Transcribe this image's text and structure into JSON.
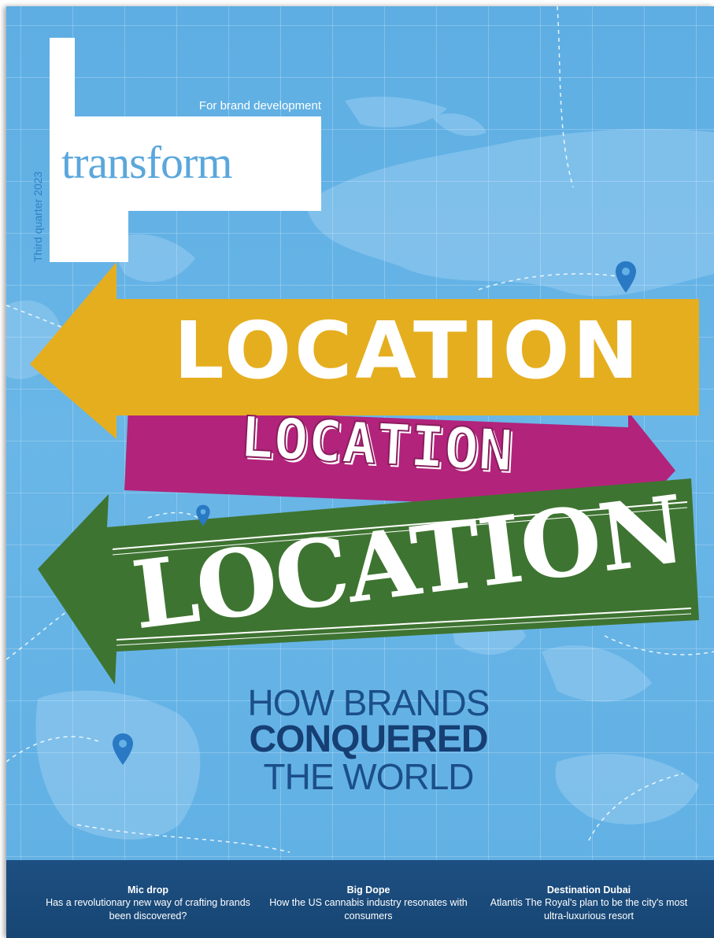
{
  "masthead": {
    "tagline": "For brand development",
    "title": "transform",
    "issue": "Third quarter 2023"
  },
  "arrows": {
    "top": {
      "text": "LOCATION",
      "color": "#e5ae1f"
    },
    "middle": {
      "text": "LOCATION",
      "color": "#b2237b"
    },
    "bottom": {
      "text": "LOCATION",
      "color": "#3e7431"
    }
  },
  "headline": {
    "line1": "HOW BRANDS",
    "line2": "CONQUERED",
    "line3": "THE WORLD"
  },
  "teasers": [
    {
      "title": "Mic drop",
      "body": "Has a revolutionary new way of crafting brands been discovered?"
    },
    {
      "title": "Big Dope",
      "body": "How the US cannabis industry resonates with consumers"
    },
    {
      "title": "Destination Dubai",
      "body": "Atlantis The Royal's plan to be the city's most ultra-luxurious resort"
    }
  ],
  "colors": {
    "background": "#63b1e5",
    "headline": "#1b4f8a",
    "footer": "#1d4f82",
    "pin": "#2a79c4"
  }
}
